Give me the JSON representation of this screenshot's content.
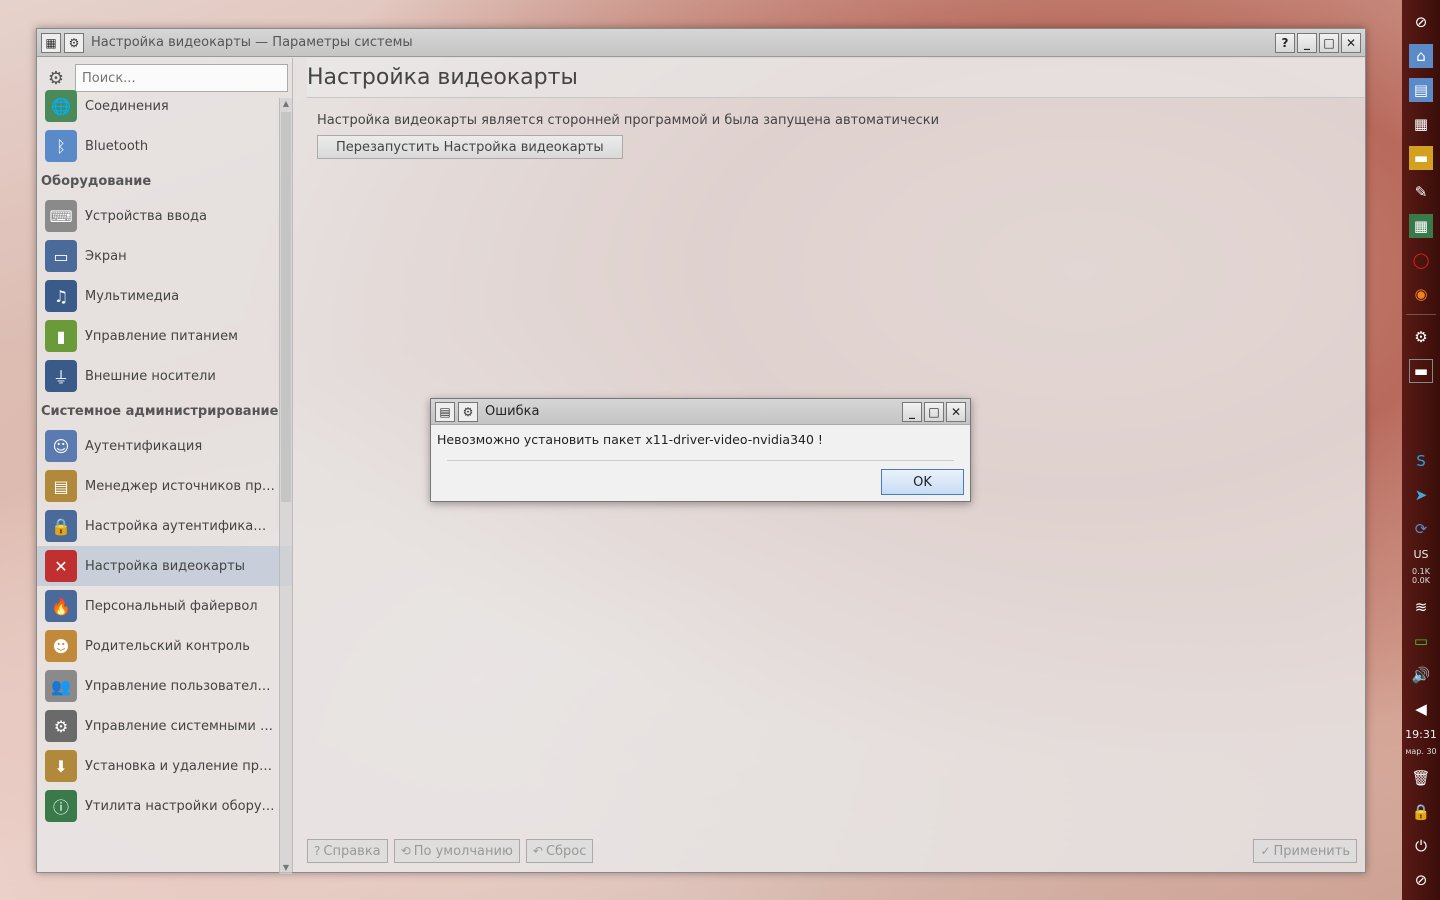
{
  "window": {
    "title": "Настройка видеокарты — Параметры системы",
    "help_icon": "question-icon",
    "close_glyph": "✕"
  },
  "sidebar": {
    "search_placeholder": "Поиск...",
    "items_top": [
      {
        "label": "Соединения",
        "icon": "network-icon",
        "color": "#4a8a5a"
      },
      {
        "label": "Bluetooth",
        "icon": "bluetooth-icon",
        "color": "#5b8ac8"
      }
    ],
    "group_hardware": "Оборудование",
    "hardware": [
      {
        "label": "Устройства ввода",
        "icon": "keyboard-icon",
        "color": "#8a8a8a"
      },
      {
        "label": "Экран",
        "icon": "monitor-icon",
        "color": "#4a6a9a"
      },
      {
        "label": "Мультимедиа",
        "icon": "headphones-icon",
        "color": "#3a5a8a"
      },
      {
        "label": "Управление питанием",
        "icon": "battery-icon",
        "color": "#6a9a3a"
      },
      {
        "label": "Внешние носители",
        "icon": "usb-icon",
        "color": "#3a5a8a"
      }
    ],
    "group_admin": "Системное администрирование",
    "admin": [
      {
        "label": "Аутентификация",
        "icon": "user-key-icon",
        "color": "#5a7ab0"
      },
      {
        "label": "Менеджер источников прогр...",
        "icon": "package-icon",
        "color": "#b08a3a"
      },
      {
        "label": "Настройка аутентификации д...",
        "icon": "lock-icon",
        "color": "#4a6a9a"
      },
      {
        "label": "Настройка видеокарты",
        "icon": "x-display-icon",
        "color": "#c03030"
      },
      {
        "label": "Персональный файервол",
        "icon": "firewall-icon",
        "color": "#4a6a9a"
      },
      {
        "label": "Родительский контроль",
        "icon": "parental-icon",
        "color": "#c08a3a"
      },
      {
        "label": "Управление пользователями",
        "icon": "users-icon",
        "color": "#8a8a8a"
      },
      {
        "label": "Управление системными слу...",
        "icon": "services-icon",
        "color": "#6a6a6a"
      },
      {
        "label": "Установка и удаление програ...",
        "icon": "install-icon",
        "color": "#b08a3a"
      },
      {
        "label": "Утилита настройки оборудов...",
        "icon": "hardware-icon",
        "color": "#3a7a4a"
      }
    ]
  },
  "content": {
    "title": "Настройка видеокарты",
    "info": "Настройка видеокарты является сторонней программой и была запущена автоматически",
    "restart_label": "Перезапустить Настройка видеокарты",
    "help_label": "Справка",
    "defaults_label": "По умолчанию",
    "reset_label": "Сброс",
    "apply_label": "Применить"
  },
  "dialog": {
    "title": "Ошибка",
    "message": "Невозможно установить пакет x11-driver-video-nvidia340 !",
    "ok_label": "OK"
  },
  "panel": {
    "time": "19:31",
    "date": "мар. 30",
    "net_up": "0.1K",
    "net_down": "0.0K",
    "lang": "US"
  }
}
